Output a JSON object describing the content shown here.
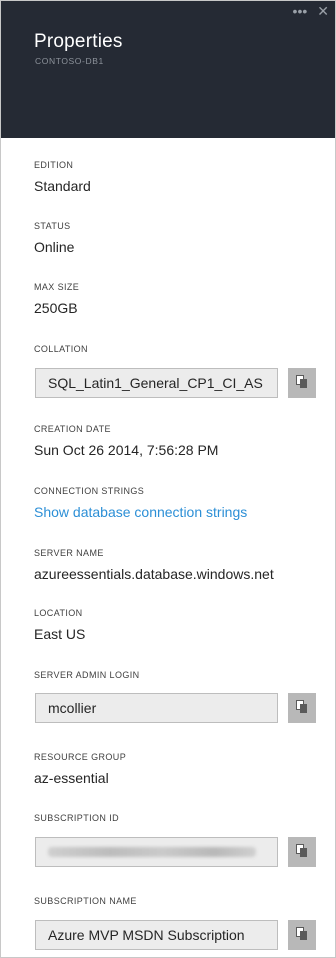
{
  "header": {
    "title": "Properties",
    "subtitle": "CONTOSO-DB1",
    "more_label": "•••",
    "close_label": "✕",
    "bg_color": "#252a34"
  },
  "fields": {
    "edition": {
      "label": "EDITION",
      "value": "Standard"
    },
    "status": {
      "label": "STATUS",
      "value": "Online"
    },
    "max_size": {
      "label": "MAX SIZE",
      "value": "250GB"
    },
    "collation": {
      "label": "COLLATION",
      "value": "SQL_Latin1_General_CP1_CI_AS"
    },
    "creation_date": {
      "label": "CREATION DATE",
      "value": "Sun Oct 26 2014, 7:56:28 PM"
    },
    "connection_strings": {
      "label": "CONNECTION STRINGS",
      "link": "Show database connection strings"
    },
    "server_name": {
      "label": "SERVER NAME",
      "value": "azureessentials.database.windows.net"
    },
    "location": {
      "label": "LOCATION",
      "value": "East US"
    },
    "server_admin_login": {
      "label": "SERVER ADMIN LOGIN",
      "value": "mcollier"
    },
    "resource_group": {
      "label": "RESOURCE GROUP",
      "value": "az-essential"
    },
    "subscription_id": {
      "label": "SUBSCRIPTION ID"
    },
    "subscription_name": {
      "label": "SUBSCRIPTION NAME",
      "value": "Azure MVP MSDN Subscription"
    }
  },
  "icons": {
    "copy": "copy-icon",
    "more": "more-icon",
    "close": "close-icon"
  },
  "colors": {
    "link": "#2c8fd6",
    "copy_button": "#b8b8b8",
    "box_fill": "#ececec"
  }
}
